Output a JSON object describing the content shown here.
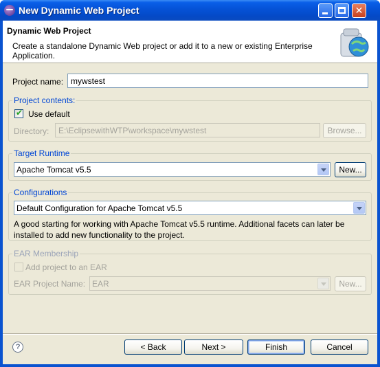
{
  "window": {
    "title": "New Dynamic Web Project"
  },
  "banner": {
    "title": "Dynamic Web Project",
    "description": "Create a standalone Dynamic Web project or add it to a new or existing Enterprise Application."
  },
  "project_name": {
    "label": "Project name:",
    "value": "mywstest"
  },
  "project_contents": {
    "title": "Project contents:",
    "use_default_label": "Use default",
    "use_default_checked": true,
    "directory_label": "Directory:",
    "directory_value": "E:\\EclipsewithWTP\\workspace\\mywstest",
    "browse_label": "Browse..."
  },
  "target_runtime": {
    "title": "Target Runtime",
    "selected": "Apache Tomcat v5.5",
    "new_label": "New..."
  },
  "configurations": {
    "title": "Configurations",
    "selected": "Default Configuration for Apache Tomcat v5.5",
    "description": "A good starting for working with Apache Tomcat v5.5 runtime. Additional facets can later be installed to add new functionality to the project."
  },
  "ear_membership": {
    "title": "EAR Membership",
    "add_label": "Add project to an EAR",
    "add_checked": false,
    "project_name_label": "EAR Project Name:",
    "project_name_value": "EAR",
    "new_label": "New..."
  },
  "footer": {
    "help": "?",
    "back": "< Back",
    "next": "Next >",
    "finish": "Finish",
    "cancel": "Cancel"
  }
}
